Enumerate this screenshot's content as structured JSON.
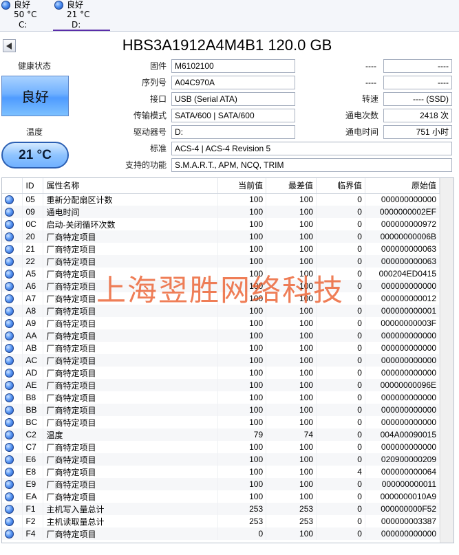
{
  "drives": [
    {
      "status": "良好",
      "temp": "50 °C",
      "letter": "C:",
      "active": false
    },
    {
      "status": "良好",
      "temp": "21 °C",
      "letter": "D:",
      "active": true
    }
  ],
  "disk_title": "HBS3A1912A4M4B1 120.0 GB",
  "health": {
    "label": "健康状态",
    "value": "良好"
  },
  "temperature": {
    "label": "温度",
    "value": "21 °C"
  },
  "info": {
    "firmware": {
      "label": "固件",
      "value": "M6102100"
    },
    "serial": {
      "label": "序列号",
      "value": "A04C970A"
    },
    "interface": {
      "label": "接口",
      "value": "USB (Serial ATA)"
    },
    "transfer_mode": {
      "label": "传输模式",
      "value": "SATA/600 | SATA/600"
    },
    "drive_letter": {
      "label": "驱动器号",
      "value": "D:"
    },
    "standard": {
      "label": "标准",
      "value": "ACS-4 | ACS-4 Revision 5"
    },
    "features": {
      "label": "支持的功能",
      "value": "S.M.A.R.T., APM, NCQ, TRIM"
    },
    "right1": {
      "label": "----",
      "value": "----"
    },
    "right2": {
      "label": "----",
      "value": "----"
    },
    "rotation": {
      "label": "转速",
      "value": "---- (SSD)"
    },
    "power_count": {
      "label": "通电次数",
      "value": "2418 次"
    },
    "power_hours": {
      "label": "通电时间",
      "value": "751 小时"
    }
  },
  "smart_headers": {
    "id": "ID",
    "name": "属性名称",
    "current": "当前值",
    "worst": "最差值",
    "threshold": "临界值",
    "raw": "原始值"
  },
  "smart_rows": [
    {
      "id": "05",
      "name": "重新分配扇区计数",
      "current": "100",
      "worst": "100",
      "threshold": "0",
      "raw": "000000000000"
    },
    {
      "id": "09",
      "name": "通电时间",
      "current": "100",
      "worst": "100",
      "threshold": "0",
      "raw": "0000000002EF"
    },
    {
      "id": "0C",
      "name": "启动-关闭循环次数",
      "current": "100",
      "worst": "100",
      "threshold": "0",
      "raw": "000000000972"
    },
    {
      "id": "20",
      "name": "厂商特定项目",
      "current": "100",
      "worst": "100",
      "threshold": "0",
      "raw": "00000000006B"
    },
    {
      "id": "21",
      "name": "厂商特定项目",
      "current": "100",
      "worst": "100",
      "threshold": "0",
      "raw": "000000000063"
    },
    {
      "id": "22",
      "name": "厂商特定项目",
      "current": "100",
      "worst": "100",
      "threshold": "0",
      "raw": "000000000063"
    },
    {
      "id": "A5",
      "name": "厂商特定项目",
      "current": "100",
      "worst": "100",
      "threshold": "0",
      "raw": "000204ED0415"
    },
    {
      "id": "A6",
      "name": "厂商特定项目",
      "current": "100",
      "worst": "100",
      "threshold": "0",
      "raw": "000000000000"
    },
    {
      "id": "A7",
      "name": "厂商特定项目",
      "current": "100",
      "worst": "100",
      "threshold": "0",
      "raw": "000000000012"
    },
    {
      "id": "A8",
      "name": "厂商特定项目",
      "current": "100",
      "worst": "100",
      "threshold": "0",
      "raw": "000000000001"
    },
    {
      "id": "A9",
      "name": "厂商特定项目",
      "current": "100",
      "worst": "100",
      "threshold": "0",
      "raw": "00000000003F"
    },
    {
      "id": "AA",
      "name": "厂商特定项目",
      "current": "100",
      "worst": "100",
      "threshold": "0",
      "raw": "000000000000"
    },
    {
      "id": "AB",
      "name": "厂商特定项目",
      "current": "100",
      "worst": "100",
      "threshold": "0",
      "raw": "000000000000"
    },
    {
      "id": "AC",
      "name": "厂商特定项目",
      "current": "100",
      "worst": "100",
      "threshold": "0",
      "raw": "000000000000"
    },
    {
      "id": "AD",
      "name": "厂商特定项目",
      "current": "100",
      "worst": "100",
      "threshold": "0",
      "raw": "000000000000"
    },
    {
      "id": "AE",
      "name": "厂商特定项目",
      "current": "100",
      "worst": "100",
      "threshold": "0",
      "raw": "00000000096E"
    },
    {
      "id": "B8",
      "name": "厂商特定项目",
      "current": "100",
      "worst": "100",
      "threshold": "0",
      "raw": "000000000000"
    },
    {
      "id": "BB",
      "name": "厂商特定项目",
      "current": "100",
      "worst": "100",
      "threshold": "0",
      "raw": "000000000000"
    },
    {
      "id": "BC",
      "name": "厂商特定项目",
      "current": "100",
      "worst": "100",
      "threshold": "0",
      "raw": "000000000000"
    },
    {
      "id": "C2",
      "name": "温度",
      "current": "79",
      "worst": "74",
      "threshold": "0",
      "raw": "004A00090015"
    },
    {
      "id": "C7",
      "name": "厂商特定项目",
      "current": "100",
      "worst": "100",
      "threshold": "0",
      "raw": "000000000000"
    },
    {
      "id": "E6",
      "name": "厂商特定项目",
      "current": "100",
      "worst": "100",
      "threshold": "0",
      "raw": "020900000209"
    },
    {
      "id": "E8",
      "name": "厂商特定项目",
      "current": "100",
      "worst": "100",
      "threshold": "4",
      "raw": "000000000064"
    },
    {
      "id": "E9",
      "name": "厂商特定项目",
      "current": "100",
      "worst": "100",
      "threshold": "0",
      "raw": "000000000011"
    },
    {
      "id": "EA",
      "name": "厂商特定项目",
      "current": "100",
      "worst": "100",
      "threshold": "0",
      "raw": "0000000010A9"
    },
    {
      "id": "F1",
      "name": "主机写入量总计",
      "current": "253",
      "worst": "253",
      "threshold": "0",
      "raw": "000000000F52"
    },
    {
      "id": "F2",
      "name": "主机读取量总计",
      "current": "253",
      "worst": "253",
      "threshold": "0",
      "raw": "000000003387"
    },
    {
      "id": "F4",
      "name": "厂商特定项目",
      "current": "0",
      "worst": "100",
      "threshold": "0",
      "raw": "000000000000"
    }
  ],
  "watermark": "上海翌胜网络科技",
  "colors": {
    "status_good": "#4f9bff",
    "tab_accent": "#5a2da8",
    "watermark": "#eb5a28"
  }
}
